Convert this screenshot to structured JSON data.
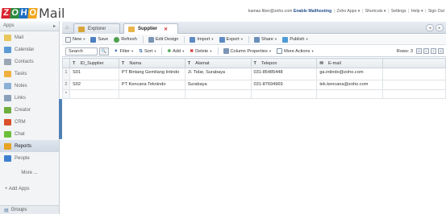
{
  "logo": {
    "letters": [
      "Z",
      "O",
      "H",
      "O"
    ],
    "letter_colors": [
      "#d9232d",
      "#2c8a3f",
      "#1b6ec2",
      "#f0a61c"
    ],
    "product": "Mail"
  },
  "topbar": {
    "user": "kamas.fiber@zoho.com",
    "enable_mailhosting": "Enable Mailhosting",
    "links": [
      "Zoho Apps ▾",
      "Shortcuts ▾",
      "Settings",
      "Help ▾",
      "Sign Out"
    ]
  },
  "sidebar": {
    "apps_label": "Apps",
    "items": [
      {
        "label": "Mail",
        "icon": "mail-icon",
        "color": "#e8c65a"
      },
      {
        "label": "Calendar",
        "icon": "calendar-icon",
        "color": "#5a9bd6"
      },
      {
        "label": "Contacts",
        "icon": "contacts-icon",
        "color": "#9aa7b5"
      },
      {
        "label": "Tasks",
        "icon": "tasks-icon",
        "color": "#f0b040"
      },
      {
        "label": "Notes",
        "icon": "notes-icon",
        "color": "#8bb0d6"
      },
      {
        "label": "Links",
        "icon": "links-icon",
        "color": "#8aa0b8"
      },
      {
        "label": "Creator",
        "icon": "creator-icon",
        "color": "#6fae3e"
      },
      {
        "label": "CRM",
        "icon": "crm-icon",
        "color": "#d9502b"
      },
      {
        "label": "Chat",
        "icon": "chat-icon",
        "color": "#6cbf3a"
      },
      {
        "label": "Reports",
        "icon": "reports-icon",
        "color": "#e7a324"
      },
      {
        "label": "People",
        "icon": "people-icon",
        "color": "#3f7fd0"
      }
    ],
    "more": "More ...",
    "add_apps": "+ Add Apps",
    "groups": "Groups"
  },
  "tabs": {
    "explorer": "Explorer",
    "supplier": "Supplier",
    "close": "✕"
  },
  "toolbar1": {
    "new": "New",
    "save": "Save",
    "refresh": "Refresh",
    "edit_design": "Edit Design",
    "import": "Import",
    "export": "Export",
    "share": "Share",
    "publish": "Publish"
  },
  "toolbar2": {
    "search_placeholder": "Search",
    "filter": "Filter",
    "sort": "Sort",
    "add": "Add",
    "delete": "Delete",
    "column_properties": "Column Properties",
    "more_actions": "More Actions",
    "rows_label": "Rows: 3"
  },
  "table": {
    "columns": [
      {
        "type": "T",
        "name": "ID_Supplier"
      },
      {
        "type": "T",
        "name": "Nama"
      },
      {
        "type": "T",
        "name": "Alamat"
      },
      {
        "type": "T",
        "name": "Telepon"
      },
      {
        "type": "✉",
        "name": "E-mail"
      }
    ],
    "rows": [
      {
        "n": "1",
        "cells": [
          "S01",
          "PT Bintang Gemilang Intindo",
          "Jl. Tidar, Surabaya",
          "031-85485448",
          "ga.intindo@zoho.com"
        ]
      },
      {
        "n": "2",
        "cells": [
          "S02",
          "PT Kencana Teknindo",
          "Surabaya",
          "031-87694969",
          "tek.kencana@zoho.com"
        ]
      },
      {
        "n": "*",
        "cells": [
          "",
          "",
          "",
          "",
          ""
        ]
      }
    ]
  }
}
